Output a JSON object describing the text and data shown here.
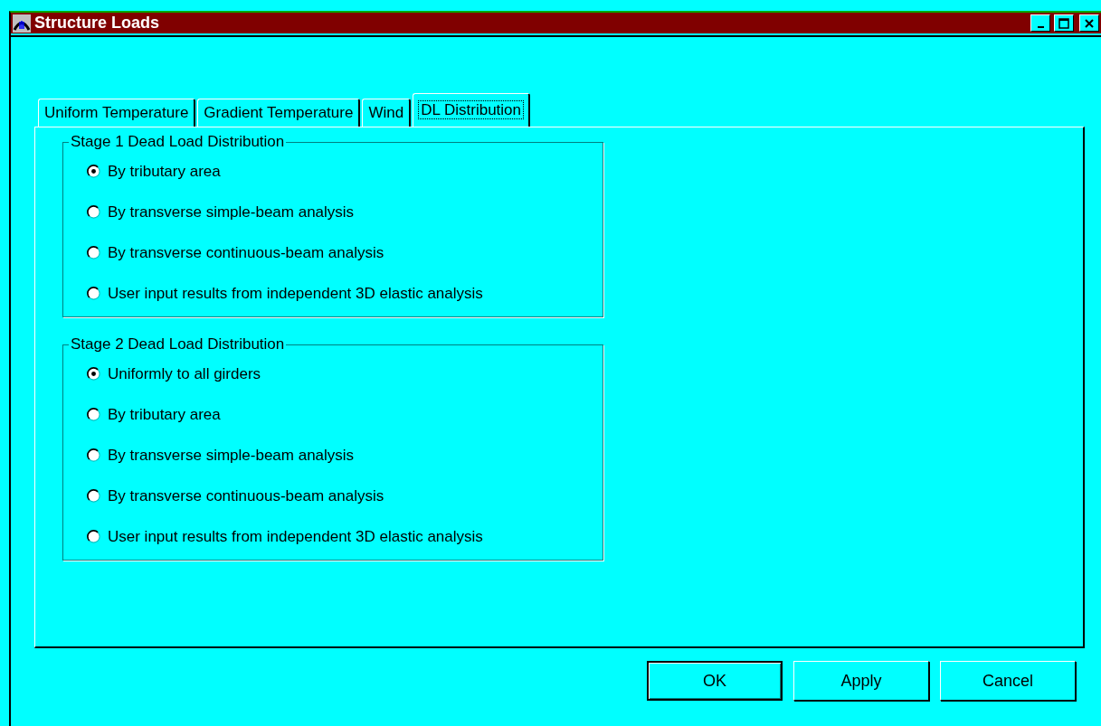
{
  "window": {
    "title": "Structure Loads"
  },
  "tabs": [
    {
      "label": "Uniform Temperature",
      "selected": false
    },
    {
      "label": "Gradient Temperature",
      "selected": false
    },
    {
      "label": "Wind",
      "selected": false
    },
    {
      "label": "DL Distribution",
      "selected": true
    }
  ],
  "groups": [
    {
      "title": "Stage 1 Dead Load Distribution",
      "options": [
        {
          "label": "By tributary area",
          "selected": true
        },
        {
          "label": "By transverse simple-beam analysis",
          "selected": false
        },
        {
          "label": "By transverse continuous-beam analysis",
          "selected": false
        },
        {
          "label": "User input results from independent 3D elastic analysis",
          "selected": false
        }
      ]
    },
    {
      "title": "Stage 2 Dead Load Distribution",
      "options": [
        {
          "label": "Uniformly to all girders",
          "selected": true
        },
        {
          "label": "By tributary area",
          "selected": false
        },
        {
          "label": "By transverse simple-beam analysis",
          "selected": false
        },
        {
          "label": "By transverse continuous-beam analysis",
          "selected": false
        },
        {
          "label": "User input results from independent 3D elastic analysis",
          "selected": false
        }
      ]
    }
  ],
  "buttons": [
    {
      "label": "OK",
      "default": true
    },
    {
      "label": "Apply",
      "default": false
    },
    {
      "label": "Cancel",
      "default": false
    }
  ]
}
